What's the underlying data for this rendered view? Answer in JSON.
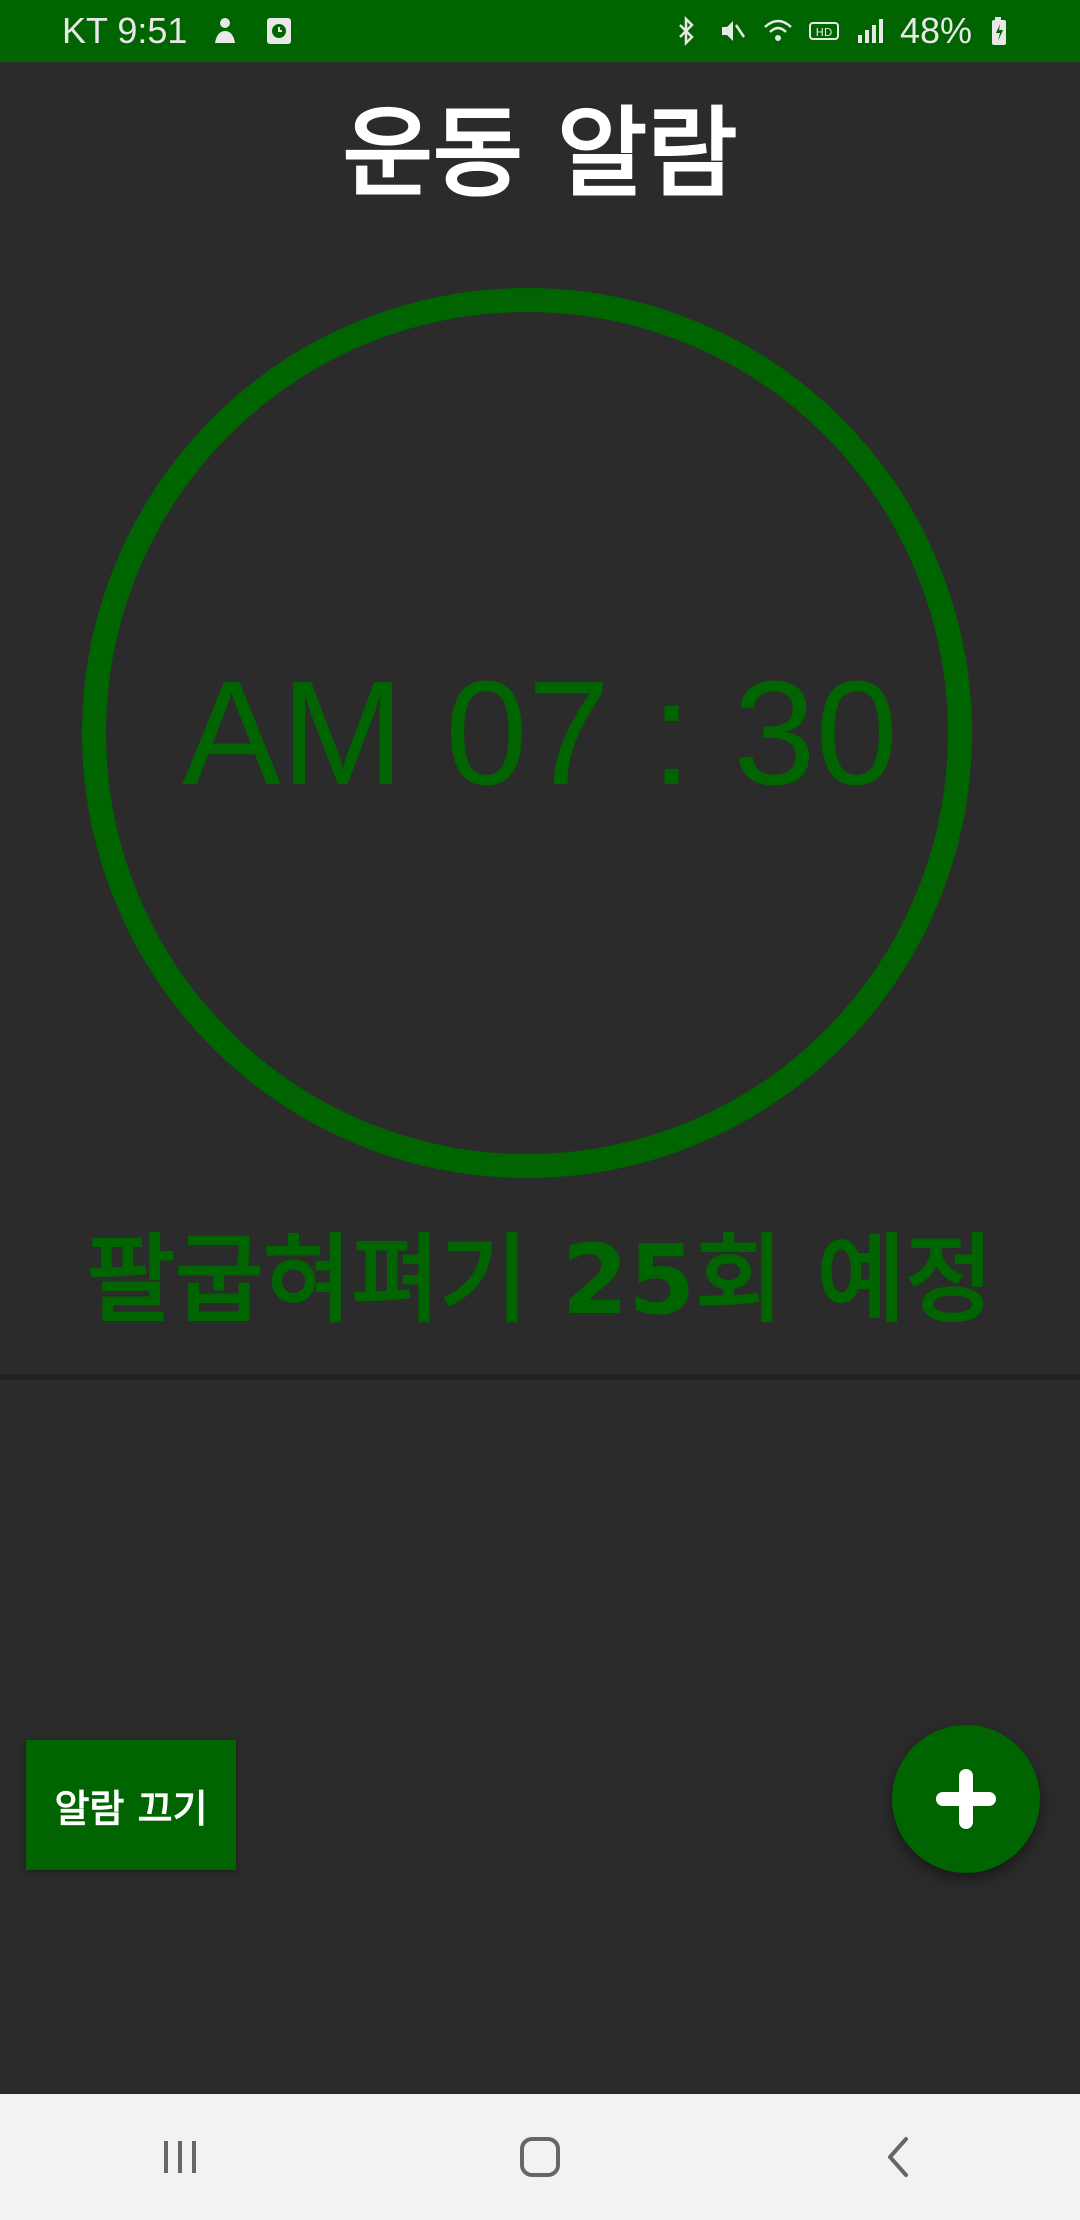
{
  "status_bar": {
    "carrier_time": "KT 9:51",
    "battery": "48%",
    "left_icons": [
      "person-icon",
      "clock-icon"
    ],
    "right_icons": [
      "bluetooth-icon",
      "vibrate-icon",
      "wifi-icon",
      "hd-icon",
      "signal-icon",
      "battery-icon"
    ]
  },
  "title": "운동 알람",
  "alarm": {
    "time": "AM 07 : 30",
    "exercise": "팔굽혀펴기 25회 예정"
  },
  "buttons": {
    "off_label": "알람 끄기",
    "add_icon": "plus-icon"
  },
  "nav_bar": {
    "icons": [
      "recents-icon",
      "home-icon",
      "back-icon"
    ]
  },
  "colors": {
    "accent": "#006400",
    "background": "#2b2b2b",
    "status_bar": "#006400",
    "nav_bar": "#f2f2f2"
  }
}
